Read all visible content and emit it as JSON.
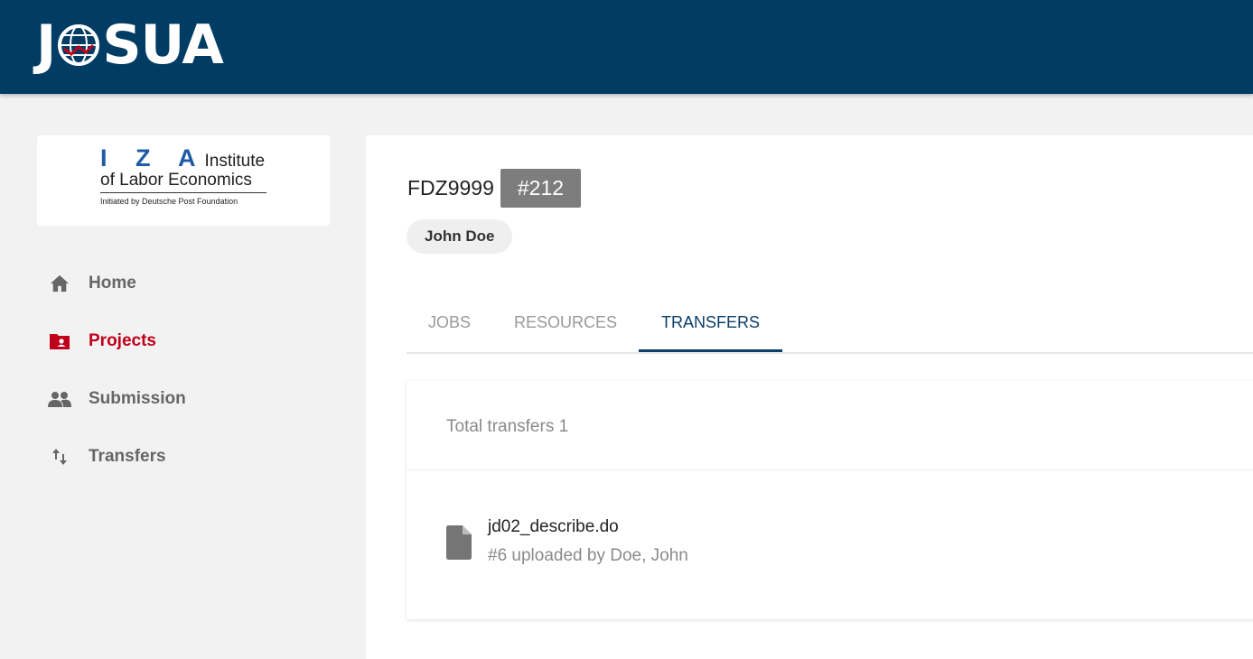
{
  "header": {
    "logo_left": "J",
    "logo_right": "SUA",
    "bg_color": "#003c64"
  },
  "org": {
    "letters": "I Z A",
    "line1": "Institute",
    "line2": "of Labor Economics",
    "line3": "Initiated by Deutsche Post Foundation"
  },
  "sidebar": {
    "items": [
      {
        "label": "Home",
        "icon": "home-icon"
      },
      {
        "label": "Projects",
        "icon": "project-folder-icon",
        "active": true
      },
      {
        "label": "Submission",
        "icon": "people-icon"
      },
      {
        "label": "Transfers",
        "icon": "swap-vert-icon"
      }
    ]
  },
  "project": {
    "name": "FDZ9999",
    "id": "#212",
    "user": "John Doe"
  },
  "tabs": [
    {
      "label": "JOBS"
    },
    {
      "label": "RESOURCES"
    },
    {
      "label": "TRANSFERS",
      "active": true
    }
  ],
  "transfers": {
    "total_label": "Total transfers 1",
    "items": [
      {
        "filename": "jd02_describe.do",
        "meta": "#6 uploaded by Doe, John",
        "icon": "file-icon"
      }
    ]
  },
  "colors": {
    "accent": "#0b3f6b",
    "active_nav": "#c0001a"
  }
}
